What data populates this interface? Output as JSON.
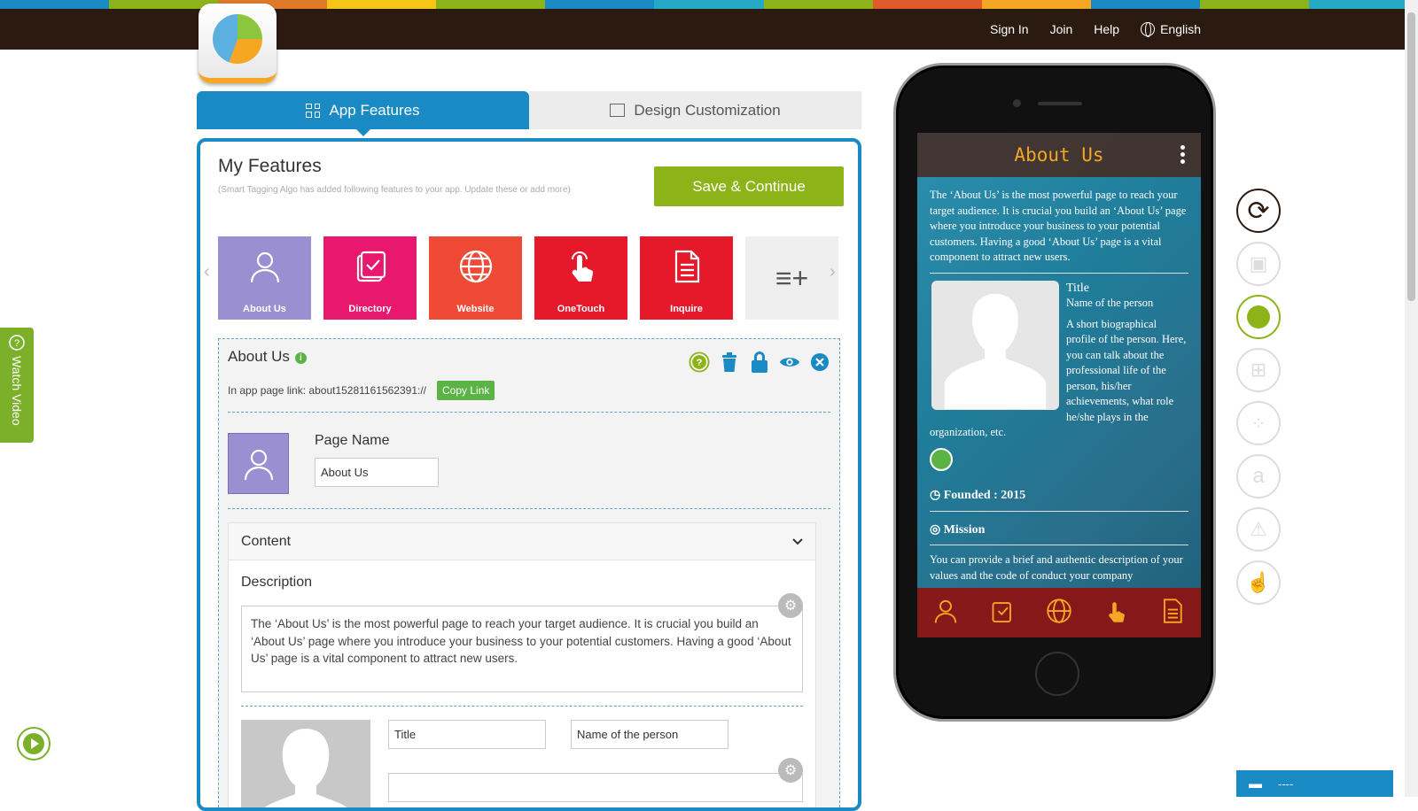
{
  "topnav": {
    "sign_in": "Sign In",
    "join": "Join",
    "help": "Help",
    "language": "English"
  },
  "tabs": [
    {
      "label": "App Features"
    },
    {
      "label": "Design Customization"
    }
  ],
  "panel": {
    "title": "My Features",
    "subtitle": "(Smart Tagging Algo has added following features to your app. Update these or add more)",
    "save_label": "Save & Continue",
    "features": [
      {
        "label": "About Us",
        "color": "#9a8fd0"
      },
      {
        "label": "Directory",
        "color": "#e8186e"
      },
      {
        "label": "Website",
        "color": "#ee4a36"
      },
      {
        "label": "OneTouch",
        "color": "#e6192b"
      },
      {
        "label": "Inquire",
        "color": "#e6192b"
      }
    ],
    "add_more": "≡+"
  },
  "editor": {
    "title": "About Us",
    "link_label": "In app page link:",
    "link_value": "about15281161562391://",
    "copy_link": "Copy Link",
    "page_name_label": "Page Name",
    "page_name_value": "About Us",
    "content_label": "Content",
    "description_label": "Description",
    "description": "The ‘About Us’ is the most powerful page to reach your target audience. It is crucial you build an ‘About Us’ page where you introduce your business to your potential customers. Having a good ‘About Us’ page is a vital component to attract new users.",
    "title_field": "Title",
    "name_field": "Name of the person"
  },
  "watch_video": "Watch Video",
  "phone": {
    "header": "About Us",
    "intro": "The ‘About Us’ is the most powerful page to reach your target audience. It is crucial you build an ‘About Us’ page where you introduce your business to your potential customers. Having a good ‘About Us’ page is a vital component to attract new users.",
    "title": "Title",
    "name": "Name of the person",
    "bio": "A short biographical profile of the person. Here, you can talk about the professional life of the person, his/her achievements, what role he/she plays in the organization, etc.",
    "founded": "Founded : 2015",
    "mission": "Mission",
    "mission_text": "You can provide a brief and authentic description of your values and the code of conduct your company"
  },
  "chat": {
    "label": "----"
  },
  "colors": {
    "brand_blue": "#1a8ac4",
    "green": "#8cb418",
    "topbar": "#2a1a10"
  }
}
